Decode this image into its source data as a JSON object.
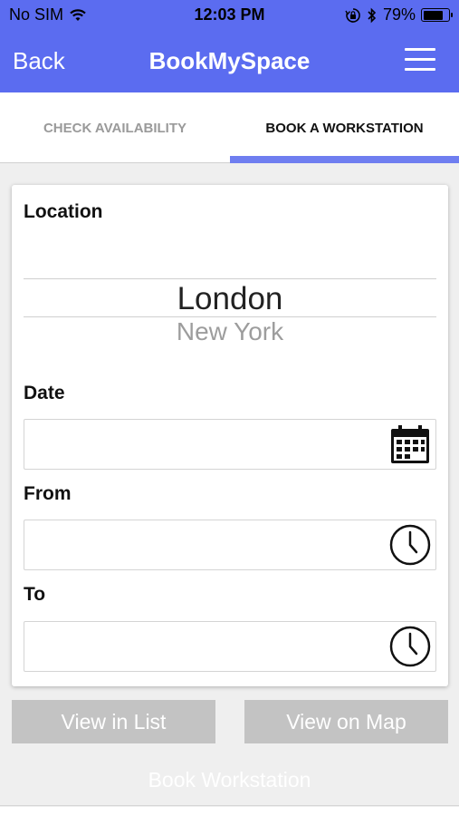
{
  "status_bar": {
    "carrier": "No SIM",
    "time": "12:03 PM",
    "battery_percent": "79%",
    "battery_level": 0.79,
    "icons": [
      "wifi-icon",
      "orientation-lock-icon",
      "bluetooth-icon",
      "battery-icon"
    ]
  },
  "nav": {
    "back_label": "Back",
    "title": "BookMySpace",
    "menu_icon": "hamburger-menu-icon"
  },
  "tabs": [
    {
      "label": "CHECK AVAILABILITY",
      "active": false
    },
    {
      "label": "BOOK A WORKSTATION",
      "active": true
    }
  ],
  "form": {
    "location": {
      "label": "Location",
      "selected": "London",
      "next_option": "New York"
    },
    "date": {
      "label": "Date",
      "value": "",
      "icon": "calendar-icon"
    },
    "from": {
      "label": "From",
      "value": "",
      "icon": "clock-icon"
    },
    "to": {
      "label": "To",
      "value": "",
      "icon": "clock-icon"
    }
  },
  "buttons": {
    "view_list": "View in List",
    "view_map": "View on Map",
    "book": "Book Workstation"
  },
  "colors": {
    "brand": "#5b6cf0",
    "tab_indicator": "#6f7ef0",
    "button_gray": "#c3c3c3",
    "background": "#efefef"
  }
}
